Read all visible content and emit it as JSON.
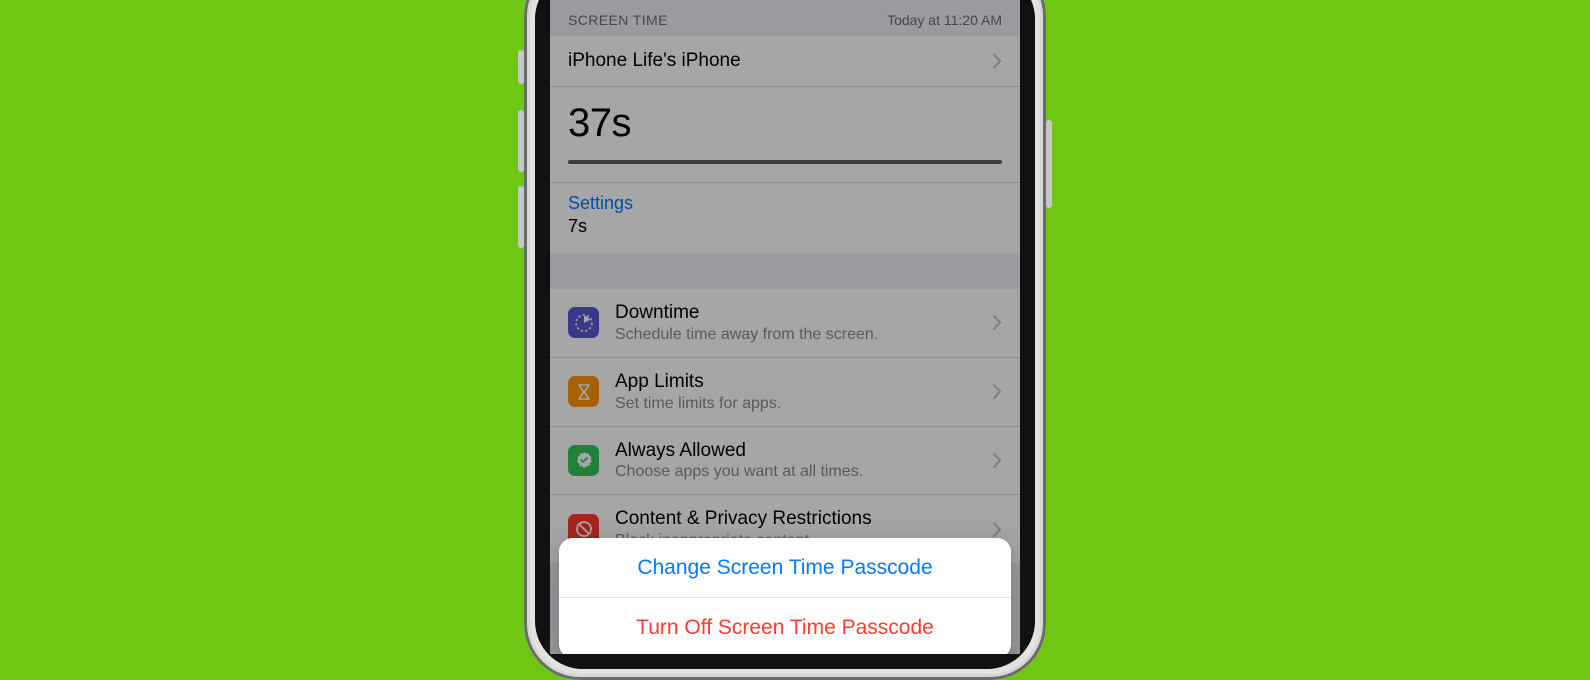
{
  "header": {
    "section_label": "SCREEN TIME",
    "timestamp": "Today at 11:20 AM"
  },
  "device": {
    "name": "iPhone Life's iPhone"
  },
  "usage": {
    "total": "37s",
    "app_name": "Settings",
    "app_time": "7s"
  },
  "options": [
    {
      "title": "Downtime",
      "subtitle": "Schedule time away from the screen.",
      "icon": "downtime-icon",
      "color": "purple"
    },
    {
      "title": "App Limits",
      "subtitle": "Set time limits for apps.",
      "icon": "hourglass-icon",
      "color": "orange"
    },
    {
      "title": "Always Allowed",
      "subtitle": "Choose apps you want at all times.",
      "icon": "check-badge-icon",
      "color": "green"
    },
    {
      "title": "Content & Privacy Restrictions",
      "subtitle": "Block inappropriate content.",
      "icon": "no-entry-icon",
      "color": "red"
    }
  ],
  "sheet": {
    "change": "Change Screen Time Passcode",
    "turn_off": "Turn Off Screen Time Passcode"
  }
}
